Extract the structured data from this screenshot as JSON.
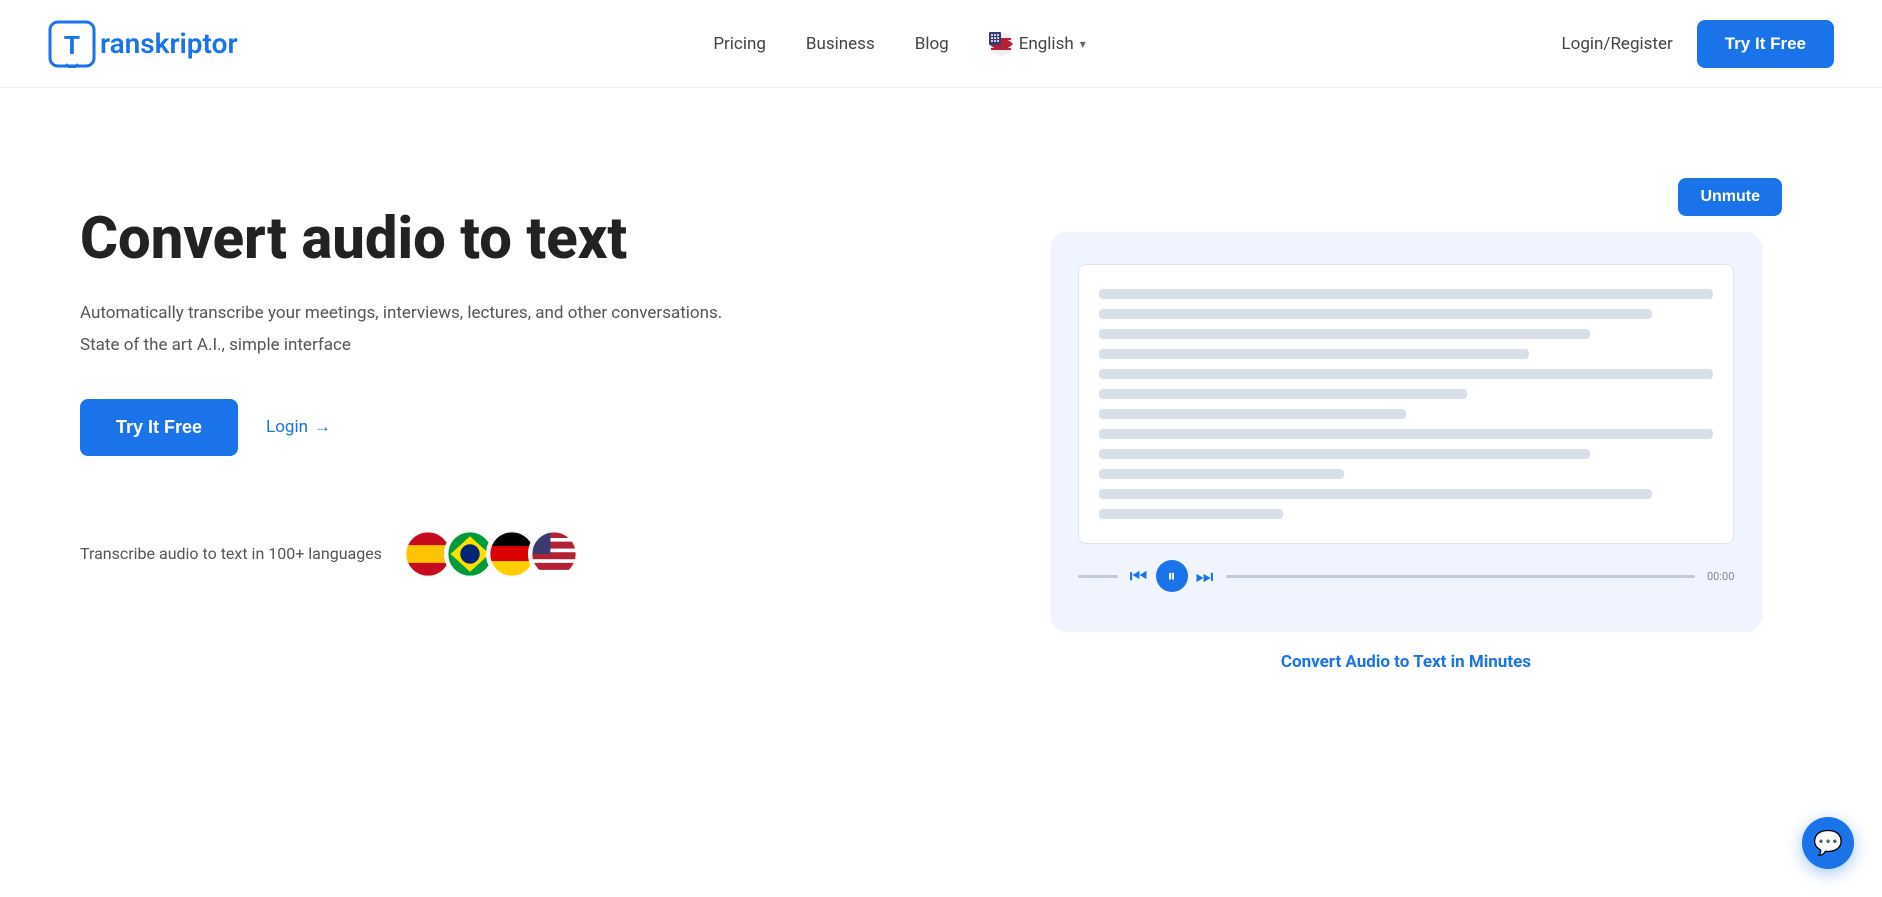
{
  "navbar": {
    "logo_text": "ranskriptor",
    "links": [
      {
        "label": "Pricing",
        "id": "pricing"
      },
      {
        "label": "Business",
        "id": "business"
      },
      {
        "label": "Blog",
        "id": "blog"
      }
    ],
    "language": "English",
    "login_label": "Login/Register",
    "try_free_label": "Try It Free"
  },
  "hero": {
    "title": "Convert audio to text",
    "subtitle": "Automatically transcribe your meetings, interviews, lectures, and other conversations.",
    "tagline": "State of the art A.I., simple interface",
    "try_free_label": "Try It Free",
    "login_label": "Login",
    "login_arrow": "→",
    "languages_text": "Transcribe audio to text in 100+ languages",
    "flags": [
      "🇪🇸",
      "🇧🇷",
      "🇩🇪",
      "🇺🇸"
    ],
    "unmute_label": "Unmute",
    "convert_label": "Convert Audio to Text in Minutes"
  },
  "icons": {
    "logo_bracket": "T",
    "chevron_down": "▾",
    "chat": "💬"
  }
}
